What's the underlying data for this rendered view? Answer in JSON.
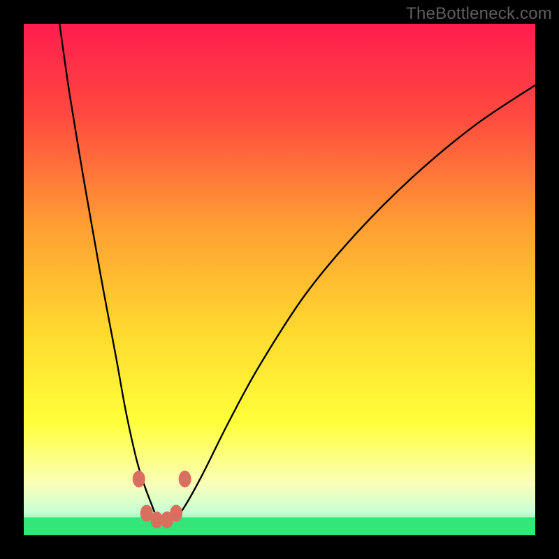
{
  "watermark": "TheBottleneck.com",
  "colors": {
    "bg_black": "#000000",
    "watermark": "#5f5f5f",
    "curve": "#000000",
    "markers": "#d9705f",
    "green_band": "#34e57a"
  },
  "chart_data": {
    "type": "line",
    "title": "",
    "xlabel": "",
    "ylabel": "",
    "xlim": [
      0,
      100
    ],
    "ylim": [
      0,
      100
    ],
    "gradient_stops": [
      {
        "pos": 0.0,
        "color": "#ff1d4e"
      },
      {
        "pos": 0.18,
        "color": "#ff4a3f"
      },
      {
        "pos": 0.4,
        "color": "#ffa033"
      },
      {
        "pos": 0.6,
        "color": "#ffd92e"
      },
      {
        "pos": 0.78,
        "color": "#ffff3a"
      },
      {
        "pos": 0.9,
        "color": "#f9ffb9"
      },
      {
        "pos": 0.955,
        "color": "#c8ffd4"
      },
      {
        "pos": 1.0,
        "color": "#34e57a"
      }
    ],
    "series": [
      {
        "name": "bottleneck-curve",
        "x": [
          7,
          9,
          12,
          15,
          18,
          20,
          22,
          23.5,
          25,
          26,
          27,
          28.5,
          30,
          32,
          35,
          40,
          46,
          55,
          65,
          76,
          88,
          100
        ],
        "y": [
          100,
          86,
          68,
          51,
          35,
          24,
          15,
          10,
          6,
          3.5,
          2.8,
          2.8,
          3.6,
          6.5,
          12,
          22,
          33,
          47,
          59,
          70,
          80,
          88
        ]
      }
    ],
    "markers": [
      {
        "x": 22.5,
        "y": 11
      },
      {
        "x": 24.0,
        "y": 4.3
      },
      {
        "x": 26.0,
        "y": 3.0
      },
      {
        "x": 28.0,
        "y": 3.0
      },
      {
        "x": 29.8,
        "y": 4.3
      },
      {
        "x": 31.5,
        "y": 11
      }
    ],
    "green_band_y_fraction": 0.965
  }
}
